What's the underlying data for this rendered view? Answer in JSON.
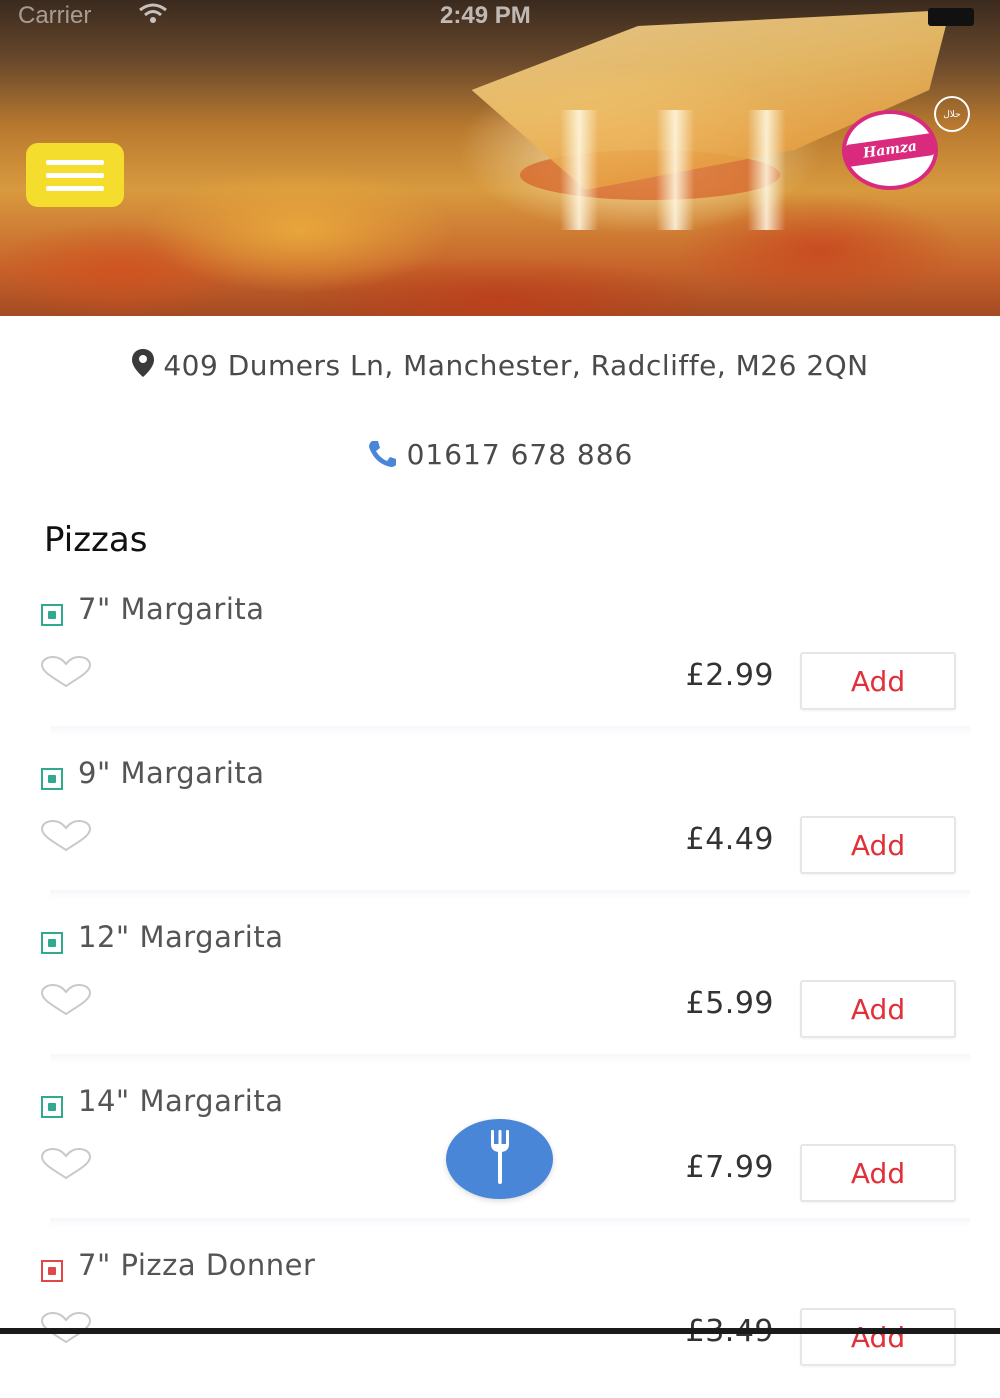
{
  "status_bar": {
    "carrier": "Carrier",
    "time": "2:49 PM"
  },
  "header": {
    "logo_text": "Hamza",
    "halal_badge_text": "حلال"
  },
  "restaurant": {
    "address": "409 Dumers Ln, Manchester, Radcliffe, M26 2QN",
    "phone": "01617 678 886"
  },
  "menu": {
    "section_title": "Pizzas",
    "add_label": "Add",
    "items": [
      {
        "name": "7\" Margarita",
        "price": "£2.99",
        "type": "veg"
      },
      {
        "name": "9\" Margarita",
        "price": "£4.49",
        "type": "veg"
      },
      {
        "name": "12\" Margarita",
        "price": "£5.99",
        "type": "veg"
      },
      {
        "name": "14\" Margarita",
        "price": "£7.99",
        "type": "veg"
      },
      {
        "name": "7\" Pizza Donner",
        "price": "£3.49",
        "type": "non-veg"
      }
    ]
  },
  "colors": {
    "accent_red": "#e0313a",
    "menu_button_yellow": "#f5dd2e",
    "fab_blue": "#4a86d8",
    "veg_green": "#2faa8f",
    "nonveg_red": "#e04848",
    "phone_icon_blue": "#4a86d8"
  },
  "icons": {
    "menu": "hamburger-icon",
    "address": "location-pin-icon",
    "phone": "phone-icon",
    "favorite": "heart-outline-icon",
    "fab": "fork-icon",
    "veg": "veg-indicator-icon",
    "nonveg": "nonveg-indicator-icon"
  }
}
